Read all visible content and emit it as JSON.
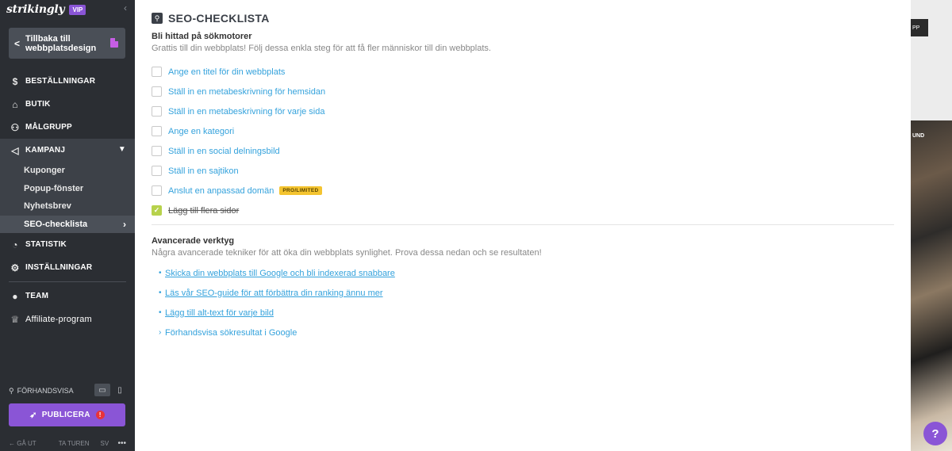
{
  "brand": {
    "name": "strikingly",
    "badge": "VIP"
  },
  "sidebar": {
    "back_label": "Tillbaka till webbplatsdesign",
    "items": [
      {
        "label": "BESTÄLLNINGAR",
        "icon": "dollar-icon"
      },
      {
        "label": "BUTIK",
        "icon": "store-icon"
      },
      {
        "label": "MÅLGRUPP",
        "icon": "people-icon"
      },
      {
        "label": "KAMPANJ",
        "icon": "megaphone-icon"
      },
      {
        "label": "STATISTIK",
        "icon": "chart-icon"
      },
      {
        "label": "INSTÄLLNINGAR",
        "icon": "gear-icon"
      },
      {
        "label": "TEAM",
        "icon": "team-icon"
      },
      {
        "label": "Affiliate-program",
        "icon": "trophy-icon"
      }
    ],
    "submenu": [
      {
        "label": "Kuponger"
      },
      {
        "label": "Popup-fönster"
      },
      {
        "label": "Nyhetsbrev"
      },
      {
        "label": "SEO-checklista"
      }
    ],
    "preview_label": "FÖRHANDSVISA",
    "publish_label": "PUBLICERA",
    "footer": {
      "exit": "GÅ UT",
      "tour": "TA TUREN",
      "lang": "SV"
    }
  },
  "main": {
    "title": "SEO-CHECKLISTA",
    "section1": {
      "heading": "Bli hittad på sökmotorer",
      "description": "Grattis till din webbplats! Följ dessa enkla steg för att få fler människor till din webbplats.",
      "checks": [
        {
          "label": "Ange en titel för din webbplats",
          "checked": false
        },
        {
          "label": "Ställ in en metabeskrivning för hemsidan",
          "checked": false
        },
        {
          "label": "Ställ in en metabeskrivning för varje sida",
          "checked": false
        },
        {
          "label": "Ange en kategori",
          "checked": false
        },
        {
          "label": "Ställ in en social delningsbild",
          "checked": false
        },
        {
          "label": "Ställ in en sajtikon",
          "checked": false
        },
        {
          "label": "Anslut en anpassad domän",
          "checked": false,
          "badge": "PRO/LIMITED"
        },
        {
          "label": "Lägg till flera sidor",
          "checked": true
        }
      ]
    },
    "section2": {
      "heading": "Avancerade verktyg",
      "description": "Några avancerade tekniker för att öka din webbplats synlighet. Prova dessa nedan och se resultaten!",
      "links": [
        {
          "label": "Skicka din webbplats till Google och bli indexerad snabbare"
        },
        {
          "label": "Läs vår SEO-guide för att förbättra din ranking ännu mer"
        },
        {
          "label": "Lägg till alt-text för varje bild"
        },
        {
          "label": "Förhandsvisa sökresultat i Google"
        }
      ]
    }
  },
  "background": {
    "app_badge": "PP",
    "label": "UND"
  },
  "help_label": "?",
  "colors": {
    "accent": "#8a55d6",
    "link": "#34a2dc",
    "sidebar": "#2b2e33",
    "check_on": "#b7d24c",
    "badge": "#f4c430"
  }
}
